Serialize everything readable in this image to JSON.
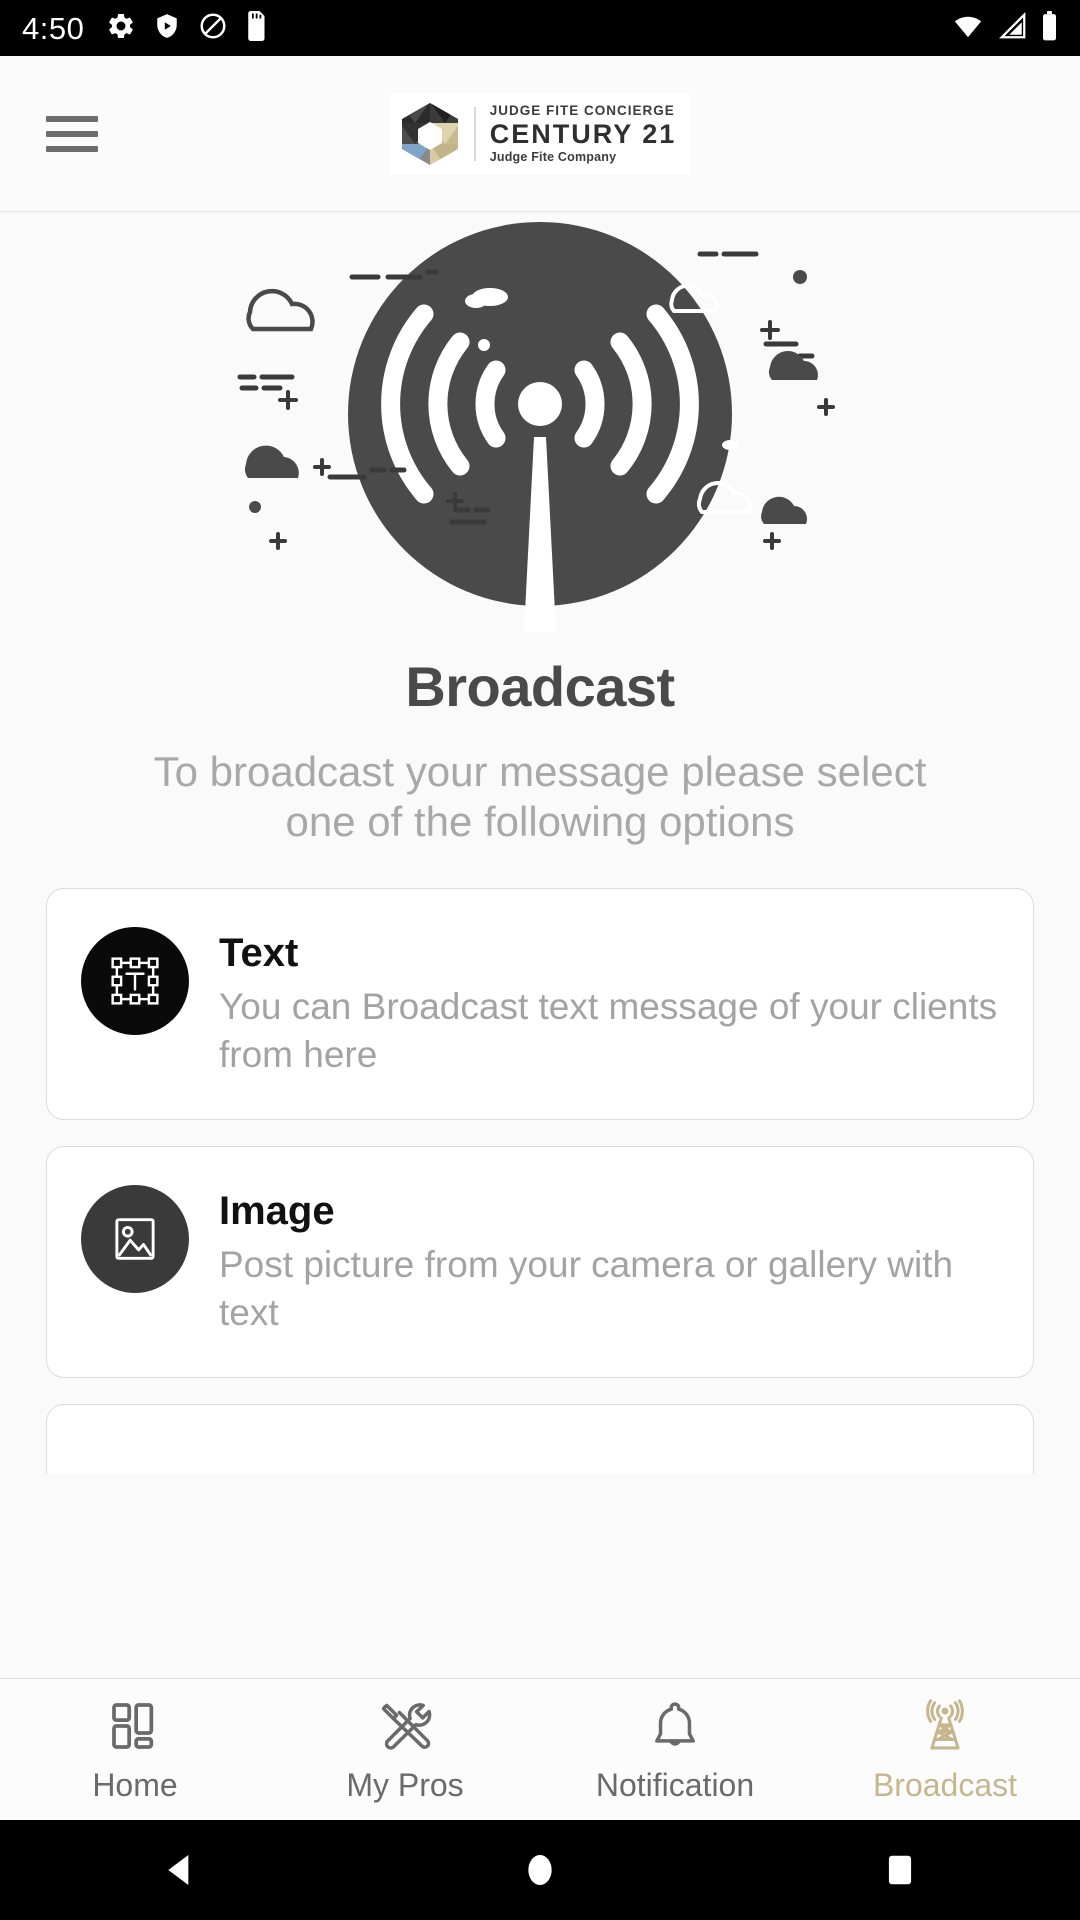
{
  "status_bar": {
    "time": "4:50",
    "left_icons": [
      "settings-gear-icon",
      "play-protect-icon",
      "do-not-disturb-icon",
      "sd-card-icon"
    ],
    "right_icons": [
      "wifi-icon",
      "cellular-signal-icon",
      "battery-icon"
    ]
  },
  "app_bar": {
    "menu_icon": "hamburger-menu-icon",
    "logo": {
      "mark": "century21-hexagon-logo",
      "line1": "JUDGE FITE CONCIERGE",
      "line2": "CENTURY 21",
      "line3": "Judge Fite Company"
    }
  },
  "main": {
    "illustration": "broadcast-tower-illustration",
    "title": "Broadcast",
    "subtitle": "To broadcast your message please select one of the following options",
    "options": [
      {
        "icon": "text-box-icon",
        "title": "Text",
        "description": "You can Broadcast text message of your clients from here"
      },
      {
        "icon": "image-picture-icon",
        "title": "Image",
        "description": "Post picture from your camera or gallery with text"
      }
    ]
  },
  "bottom_nav": {
    "items": [
      {
        "label": "Home",
        "icon": "grid-dashboard-icon",
        "active": false
      },
      {
        "label": "My Pros",
        "icon": "tools-wrench-icon",
        "active": false
      },
      {
        "label": "Notification",
        "icon": "bell-icon",
        "active": false
      },
      {
        "label": "Broadcast",
        "icon": "broadcast-tower-icon",
        "active": true
      }
    ]
  },
  "android_nav": {
    "back": "back-triangle-icon",
    "home": "home-circle-icon",
    "recents": "recents-square-icon"
  },
  "colors": {
    "accent": "#c5b68e",
    "illustration_dark": "#4a4a4a",
    "text_primary": "#111111",
    "text_muted": "#a3a3a3",
    "status_bar_bg": "#000000",
    "page_bg": "#fafafa"
  }
}
